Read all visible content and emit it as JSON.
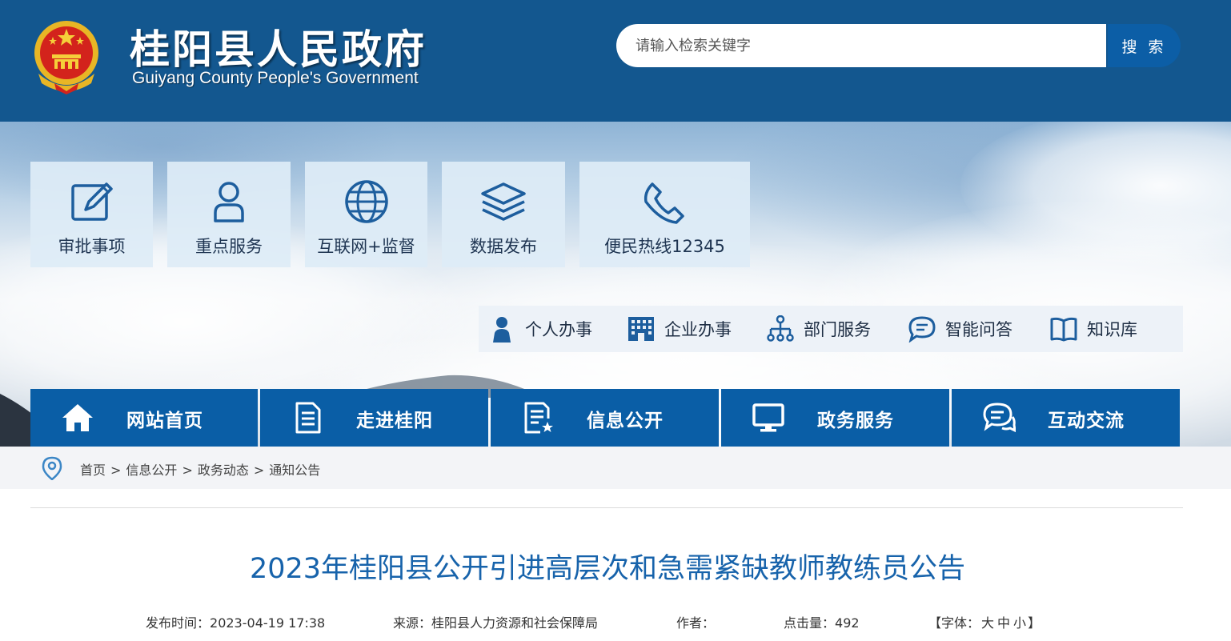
{
  "header": {
    "title": "桂阳县人民政府",
    "subtitle": "Guiyang County People's Government",
    "search_placeholder": "请输入检索关键字",
    "search_button": "搜 索"
  },
  "service_tiles": [
    {
      "label": "审批事项",
      "icon": "edit-icon"
    },
    {
      "label": "重点服务",
      "icon": "person-icon"
    },
    {
      "label": "互联网+监督",
      "icon": "globe-icon"
    },
    {
      "label": "数据发布",
      "icon": "layers-icon"
    },
    {
      "label": "便民热线12345",
      "icon": "phone-icon"
    }
  ],
  "quick_links": [
    {
      "label": "个人办事",
      "icon": "person-solid-icon"
    },
    {
      "label": "企业办事",
      "icon": "building-icon"
    },
    {
      "label": "部门服务",
      "icon": "org-chart-icon"
    },
    {
      "label": "智能问答",
      "icon": "chat-bubble-icon"
    },
    {
      "label": "知识库",
      "icon": "book-icon"
    }
  ],
  "main_nav": [
    {
      "label": "网站首页",
      "icon": "home-icon"
    },
    {
      "label": "走进桂阳",
      "icon": "document-icon"
    },
    {
      "label": "信息公开",
      "icon": "document-star-icon"
    },
    {
      "label": "政务服务",
      "icon": "monitor-icon"
    },
    {
      "label": "互动交流",
      "icon": "chat-icon"
    }
  ],
  "breadcrumb": [
    "首页",
    "信息公开",
    "政务动态",
    "通知公告"
  ],
  "breadcrumb_separator": ">",
  "article": {
    "title": "2023年桂阳县公开引进高层次和急需紧缺教师教练员公告",
    "publish_time_label": "发布时间：",
    "publish_time": "2023-04-19 17:38",
    "source_label": "来源：",
    "source": "桂阳县人力资源和社会保障局",
    "author_label": "作者：",
    "author": "",
    "views_label": "点击量：",
    "views": "492",
    "font_label_open": "【字体：",
    "font_large": "大",
    "font_medium": "中",
    "font_small": "小",
    "font_label_close": "】"
  },
  "colors": {
    "header_bg": "#13578f",
    "nav_bg": "#0a5ea6",
    "title_blue": "#1763ab",
    "tile_bg": "#deecf6",
    "icon_blue": "#1d5e9e"
  }
}
